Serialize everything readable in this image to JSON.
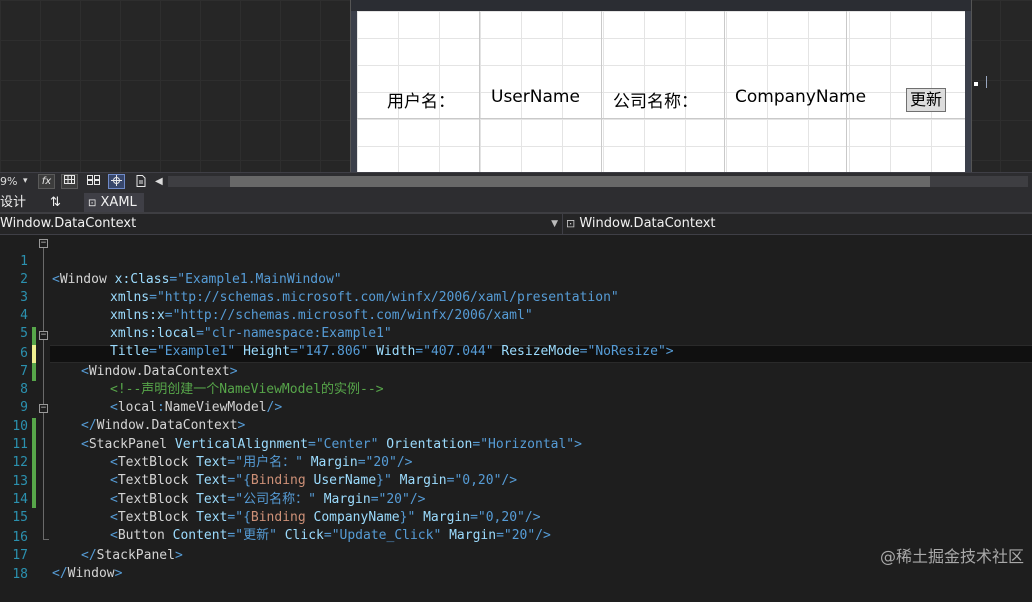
{
  "preview": {
    "label_username": "用户名：",
    "value_username": "UserName",
    "label_company": "公司名称：",
    "value_company": "CompanyName",
    "update_button": "更新"
  },
  "toolbar": {
    "zoom": "9%",
    "fx": "fx",
    "zoom_arrow": "▾"
  },
  "tabs": {
    "design": "设计",
    "swap": "⇅",
    "xaml": "XAML"
  },
  "nav": {
    "left": "Window.DataContext",
    "right": "Window.DataContext"
  },
  "code": {
    "line_numbers": [
      "1",
      "2",
      "3",
      "4",
      "5",
      "6",
      "7",
      "8",
      "9",
      "10",
      "11",
      "12",
      "13",
      "14",
      "15",
      "16",
      "17",
      "18"
    ],
    "l1": {
      "open": "<",
      "el": "Window",
      "a1": " x:Class",
      "eq": "=",
      "v1": "\"Example1.MainWindow\""
    },
    "l2": {
      "a": "xmlns",
      "v": "\"http://schemas.microsoft.com/winfx/2006/xaml/presentation\""
    },
    "l3": {
      "a": "xmlns:x",
      "v": "\"http://schemas.microsoft.com/winfx/2006/xaml\""
    },
    "l4": {
      "a": "xmlns:local",
      "v": "\"clr-namespace:Example1\""
    },
    "l5": {
      "a1": "Title",
      "v1": "\"Example1\"",
      "a2": " Height",
      "v2": "\"147.806\"",
      "a3": " Width",
      "v3": "\"407.044\"",
      "a4": " ResizeMode",
      "v4": "\"NoResize\"",
      "close": ">"
    },
    "l6": {
      "open": "<",
      "el": "Window.DataContext",
      "close": ">"
    },
    "l7": {
      "comment": "<!--声明创建一个NameViewModel的实例-->"
    },
    "l8": {
      "open": "<",
      "el": "local",
      "colon": ":",
      "el2": "NameViewModel",
      "close": "/>"
    },
    "l9": {
      "open": "</",
      "el": "Window.DataContext",
      "close": ">"
    },
    "l10": {
      "open": "<",
      "el": "StackPanel",
      "a1": " VerticalAlignment",
      "v1": "\"Center\"",
      "a2": " Orientation",
      "v2": "\"Horizontal\"",
      "close": ">"
    },
    "l11": {
      "open": "<",
      "el": "TextBlock",
      "a1": " Text",
      "v1": "\"用户名：\"",
      "a2": " Margin",
      "v2": "\"20\"",
      "close": "/>"
    },
    "l12": {
      "open": "<",
      "el": "TextBlock",
      "a1": " Text",
      "v1a": "\"{",
      "v1b": "Binding",
      "v1c": " UserName",
      "v1d": "}\"",
      "a2": " Margin",
      "v2": "\"0,20\"",
      "close": "/>"
    },
    "l13": {
      "open": "<",
      "el": "TextBlock",
      "a1": " Text",
      "v1": "\"公司名称：\"",
      "a2": " Margin",
      "v2": "\"20\"",
      "close": "/>"
    },
    "l14": {
      "open": "<",
      "el": "TextBlock",
      "a1": " Text",
      "v1a": "\"{",
      "v1b": "Binding",
      "v1c": " CompanyName",
      "v1d": "}\"",
      "a2": " Margin",
      "v2": "\"0,20\"",
      "close": "/>"
    },
    "l15": {
      "open": "<",
      "el": "Button",
      "a1": " Content",
      "v1": "\"更新\"",
      "a2": " Click",
      "v2": "\"Update_Click\"",
      "a3": " Margin",
      "v3": "\"20\"",
      "close": "/>"
    },
    "l16": {
      "open": "</",
      "el": "StackPanel",
      "close": ">"
    },
    "l17": {
      "open": "</",
      "el": "Window",
      "close": ">"
    }
  },
  "watermark": "@稀土掘金技术社区",
  "colors": {
    "tag": "#569cd6",
    "attribute": "#9cdcfe",
    "binding": "#ce9178",
    "comment": "#57a64a",
    "line_number": "#2b91af"
  }
}
